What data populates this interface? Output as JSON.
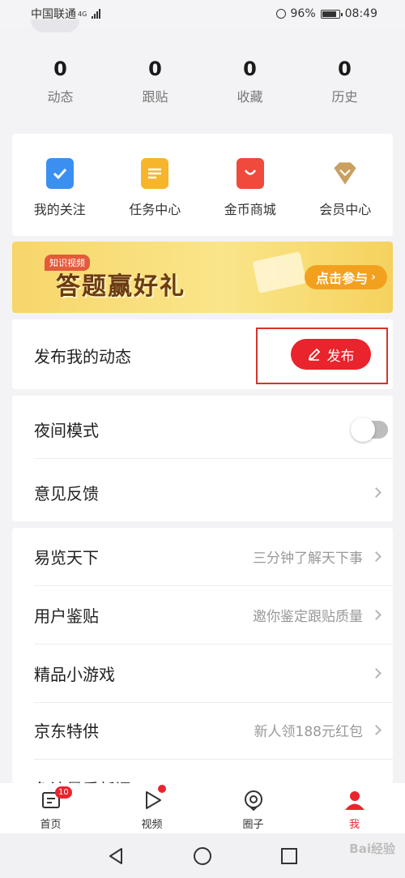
{
  "status_bar": {
    "carrier": "中国联通",
    "network": "4G",
    "battery": "96%",
    "time": "08:49"
  },
  "stats": [
    {
      "count": "0",
      "label": "动态"
    },
    {
      "count": "0",
      "label": "跟贴"
    },
    {
      "count": "0",
      "label": "收藏"
    },
    {
      "count": "0",
      "label": "历史"
    }
  ],
  "quick_actions": [
    {
      "label": "我的关注",
      "icon": "bookmark-icon",
      "color": "#3b8ff0"
    },
    {
      "label": "任务中心",
      "icon": "task-list-icon",
      "color": "#f6b52a"
    },
    {
      "label": "金币商城",
      "icon": "shopping-bag-icon",
      "color": "#ef4a3c"
    },
    {
      "label": "会员中心",
      "icon": "diamond-icon",
      "color": "#c9a060"
    }
  ],
  "banner": {
    "tag": "知识视频",
    "title": "答题赢好礼",
    "button": "点击参与"
  },
  "publish": {
    "label": "发布我的动态",
    "button": "发布"
  },
  "settings": [
    {
      "label": "夜间模式",
      "toggle": false
    },
    {
      "label": "意见反馈"
    }
  ],
  "list": [
    {
      "label": "易览天下",
      "sub": "三分钟了解天下事"
    },
    {
      "label": "用户鉴贴",
      "sub": "邀你鉴定跟贴质量"
    },
    {
      "label": "精品小游戏",
      "sub": ""
    },
    {
      "label": "京东特供",
      "sub": "新人领188元红包"
    },
    {
      "label": "免流量看新闻",
      "sub": ""
    }
  ],
  "tabs": [
    {
      "label": "首页",
      "badge": "10"
    },
    {
      "label": "视频"
    },
    {
      "label": "圈子"
    },
    {
      "label": "我"
    }
  ],
  "colors": {
    "accent": "#e9242c",
    "highlight_box": "#d8332b"
  },
  "watermark": "Bai经验"
}
